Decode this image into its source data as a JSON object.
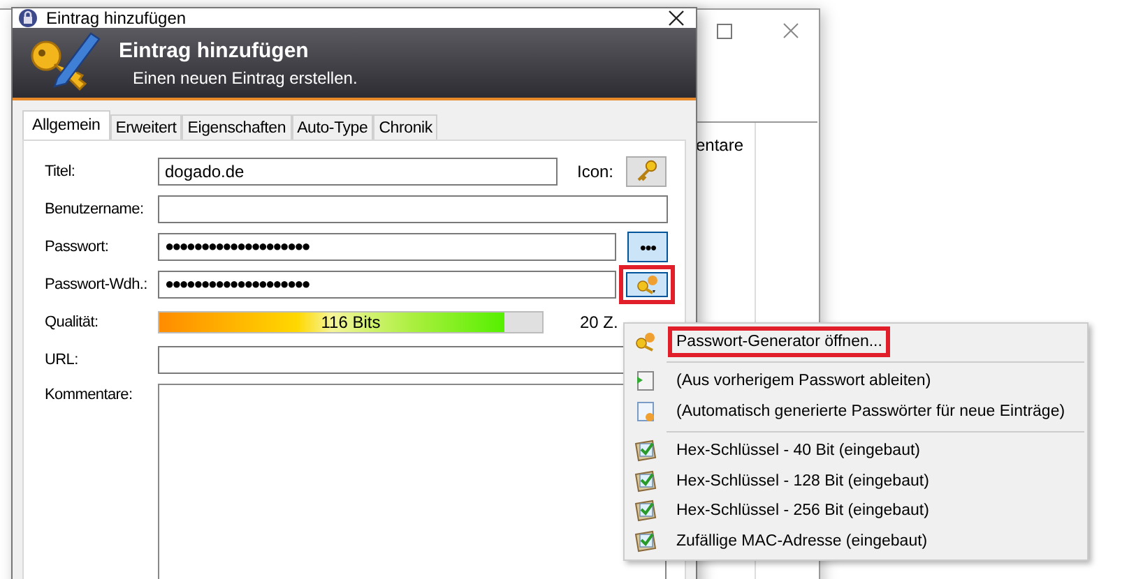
{
  "background_window": {
    "column_header": "entare"
  },
  "window": {
    "title": "Eintrag hinzufügen"
  },
  "banner": {
    "title": "Eintrag hinzufügen",
    "subtitle": "Einen neuen Eintrag erstellen."
  },
  "tabs": [
    {
      "label": "Allgemein",
      "selected": true
    },
    {
      "label": "Erweitert",
      "selected": false
    },
    {
      "label": "Eigenschaften",
      "selected": false
    },
    {
      "label": "Auto-Type",
      "selected": false
    },
    {
      "label": "Chronik",
      "selected": false
    }
  ],
  "fields": [
    {
      "kind": "title",
      "label": "Titel:",
      "value": "dogado.de",
      "icon_label": "Icon:"
    },
    {
      "kind": "text",
      "label": "Benutzername:"
    },
    {
      "kind": "password",
      "label": "Passwort:",
      "value": "●●●●●●●●●●●●●●●●●●●●",
      "button": "●●●"
    },
    {
      "kind": "repeat",
      "label": "Passwort-Wdh.:",
      "value": "●●●●●●●●●●●●●●●●●●●●",
      "annotated": true
    },
    {
      "kind": "quality",
      "label": "Qualität:",
      "level": 0.9,
      "reading": "116 Bits",
      "count": "20 Z."
    },
    {
      "kind": "text",
      "label": "URL:"
    },
    {
      "kind": "notes",
      "label": "Kommentare:"
    }
  ],
  "menu": [
    {
      "kind": "generator",
      "label": "Passwort-Generator öffnen...",
      "annotated": true
    },
    {
      "kind": "separator"
    },
    {
      "kind": "derive",
      "label": "(Aus vorherigem Passwort ableiten)",
      "annotated": false
    },
    {
      "kind": "auto",
      "label": "(Automatisch generierte Passwörter für neue Einträge)",
      "annotated": false
    },
    {
      "kind": "separator"
    },
    {
      "kind": "profile",
      "label": "Hex-Schlüssel - 40 Bit (eingebaut)",
      "annotated": false
    },
    {
      "kind": "profile",
      "label": "Hex-Schlüssel - 128 Bit (eingebaut)",
      "annotated": false
    },
    {
      "kind": "profile",
      "label": "Hex-Schlüssel - 256 Bit (eingebaut)",
      "annotated": false
    },
    {
      "kind": "profile",
      "label": "Zufällige MAC-Adresse (eingebaut)",
      "annotated": false
    }
  ]
}
